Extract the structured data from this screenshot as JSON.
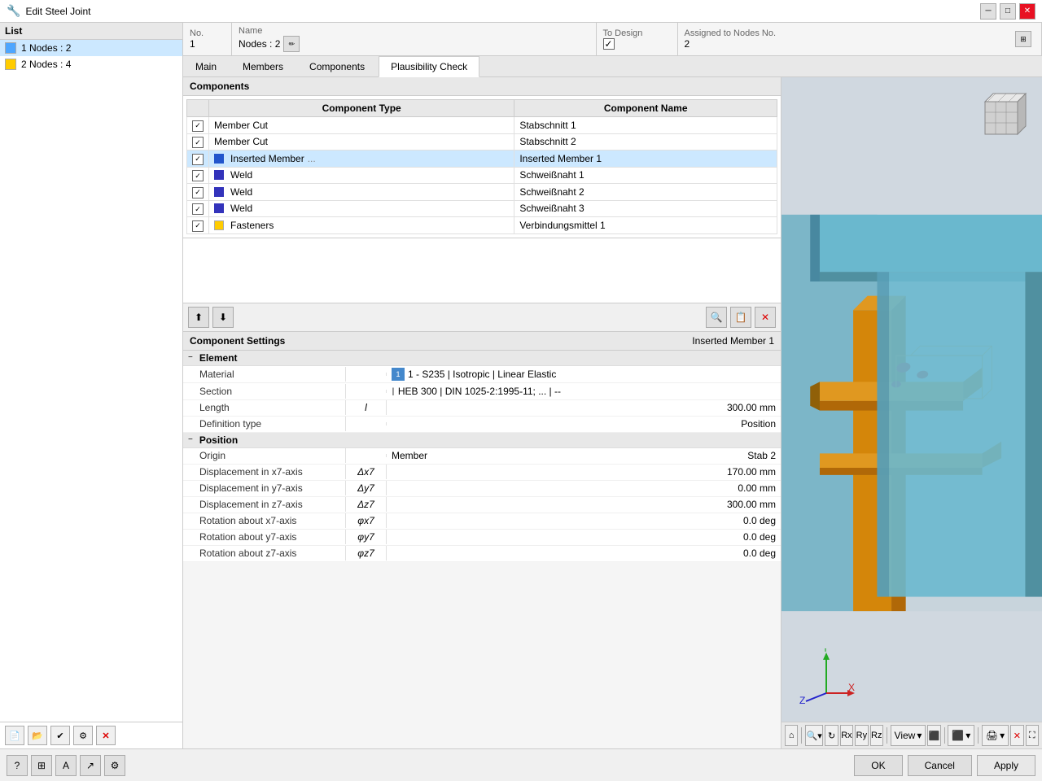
{
  "window": {
    "title": "Edit Steel Joint",
    "controls": [
      "minimize",
      "maximize",
      "close"
    ]
  },
  "list": {
    "header": "List",
    "items": [
      {
        "id": 1,
        "label": "1  Nodes : 2",
        "color": "#4da6ff",
        "selected": true
      },
      {
        "id": 2,
        "label": "2  Nodes : 4",
        "color": "#ffcc00",
        "selected": false
      }
    ],
    "toolbar_buttons": [
      "new",
      "open",
      "check",
      "settings",
      "delete"
    ]
  },
  "meta": {
    "no_label": "No.",
    "no_value": "1",
    "name_label": "Name",
    "name_value": "Nodes : 2",
    "to_design_label": "To Design",
    "to_design_checked": true,
    "assigned_label": "Assigned to Nodes No.",
    "assigned_value": "2"
  },
  "tabs": [
    {
      "id": "main",
      "label": "Main",
      "active": false
    },
    {
      "id": "members",
      "label": "Members",
      "active": false
    },
    {
      "id": "components",
      "label": "Components",
      "active": false
    },
    {
      "id": "plausibility",
      "label": "Plausibility Check",
      "active": true
    }
  ],
  "components_section": {
    "header": "Components",
    "table": {
      "headers": [
        "Component Type",
        "Component Name"
      ],
      "rows": [
        {
          "checked": true,
          "color": null,
          "type": "Member Cut",
          "name": "Stabschnitt 1",
          "selected": false
        },
        {
          "checked": true,
          "color": null,
          "type": "Member Cut",
          "name": "Stabschnitt 2",
          "selected": false
        },
        {
          "checked": true,
          "color": "#2255cc",
          "type": "Inserted Member",
          "name": "Inserted Member 1",
          "selected": true,
          "has_dots": true
        },
        {
          "checked": true,
          "color": "#3333bb",
          "type": "Weld",
          "name": "Schweißnaht 1",
          "selected": false
        },
        {
          "checked": true,
          "color": "#3333bb",
          "type": "Weld",
          "name": "Schweißnaht 2",
          "selected": false
        },
        {
          "checked": true,
          "color": "#3333bb",
          "type": "Weld",
          "name": "Schweißnaht 3",
          "selected": false
        },
        {
          "checked": true,
          "color": "#ffcc00",
          "type": "Fasteners",
          "name": "Verbindungsmittel 1",
          "selected": false
        }
      ]
    },
    "toolbar_icons": [
      "add_up",
      "add_down",
      "edit",
      "duplicate",
      "delete"
    ]
  },
  "component_settings": {
    "header": "Component Settings",
    "subtitle": "Inserted Member 1",
    "element_section": {
      "label": "Element",
      "properties": [
        {
          "label": "Material",
          "symbol": "",
          "value": "1 - S235 | Isotropic | Linear Elastic",
          "type": "material"
        },
        {
          "label": "Section",
          "symbol": "",
          "value": "HEB 300 | DIN 1025-2:1995-11; ... | --",
          "type": "section"
        },
        {
          "label": "Length",
          "symbol": "l",
          "value": "300.00  mm",
          "type": "value"
        },
        {
          "label": "Definition type",
          "symbol": "",
          "value": "Position",
          "type": "text"
        }
      ]
    },
    "position_section": {
      "label": "Position",
      "properties": [
        {
          "label": "Origin",
          "symbol": "",
          "value": "Member",
          "value2": "Stab 2",
          "type": "dual"
        },
        {
          "label": "Displacement in x7-axis",
          "symbol": "Δx7",
          "value": "170.00  mm",
          "type": "value"
        },
        {
          "label": "Displacement in y7-axis",
          "symbol": "Δy7",
          "value": "0.00  mm",
          "type": "value"
        },
        {
          "label": "Displacement in z7-axis",
          "symbol": "Δz7",
          "value": "300.00  mm",
          "type": "value"
        },
        {
          "label": "Rotation about x7-axis",
          "symbol": "φx7",
          "value": "0.0  deg",
          "type": "value"
        },
        {
          "label": "Rotation about y7-axis",
          "symbol": "φy7",
          "value": "0.0  deg",
          "type": "value"
        },
        {
          "label": "Rotation about z7-axis",
          "symbol": "φz7",
          "value": "0.0  deg",
          "type": "value"
        }
      ]
    }
  },
  "bottom_bar": {
    "status_icons": [
      "help",
      "grid",
      "text",
      "arrow",
      "settings"
    ],
    "buttons": {
      "ok": "OK",
      "cancel": "Cancel",
      "apply": "Apply"
    }
  },
  "viewport": {
    "nav_cube_visible": true
  }
}
